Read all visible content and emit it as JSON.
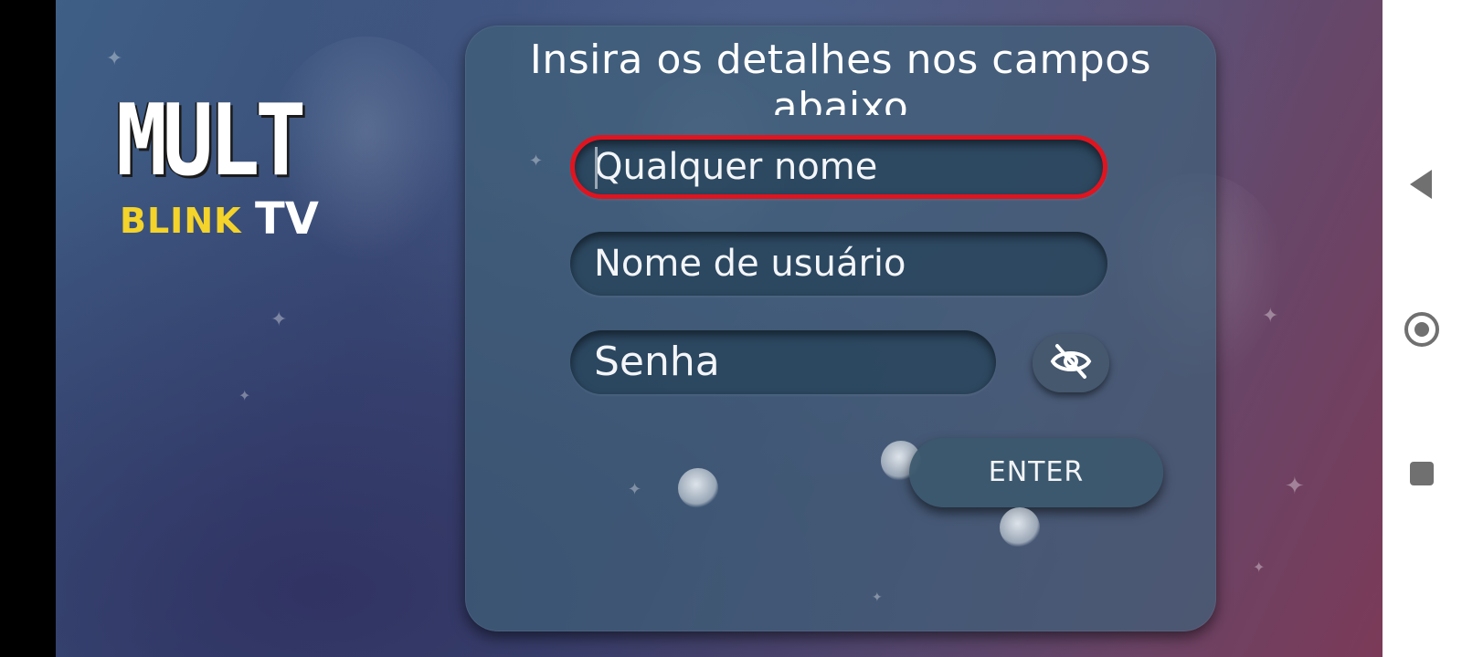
{
  "logo": {
    "line1": "MULT",
    "line2_left": "BLINK",
    "line2_right": "TV"
  },
  "form": {
    "title": "Insira os detalhes nos campos abaixo",
    "fields": {
      "name": {
        "placeholder": "Qualquer nome",
        "focused": true
      },
      "username": {
        "placeholder": "Nome de usuário"
      },
      "password": {
        "placeholder": "Senha"
      }
    },
    "toggle_visibility_icon": "eye-off-icon",
    "enter_label": "ENTER"
  },
  "navigation_bar": {
    "back_icon": "back-triangle-icon",
    "home_icon": "home-circle-icon",
    "recents_icon": "recents-square-icon"
  },
  "colors": {
    "focus_ring": "#e0141f",
    "logo_yellow": "#f4d32a"
  }
}
